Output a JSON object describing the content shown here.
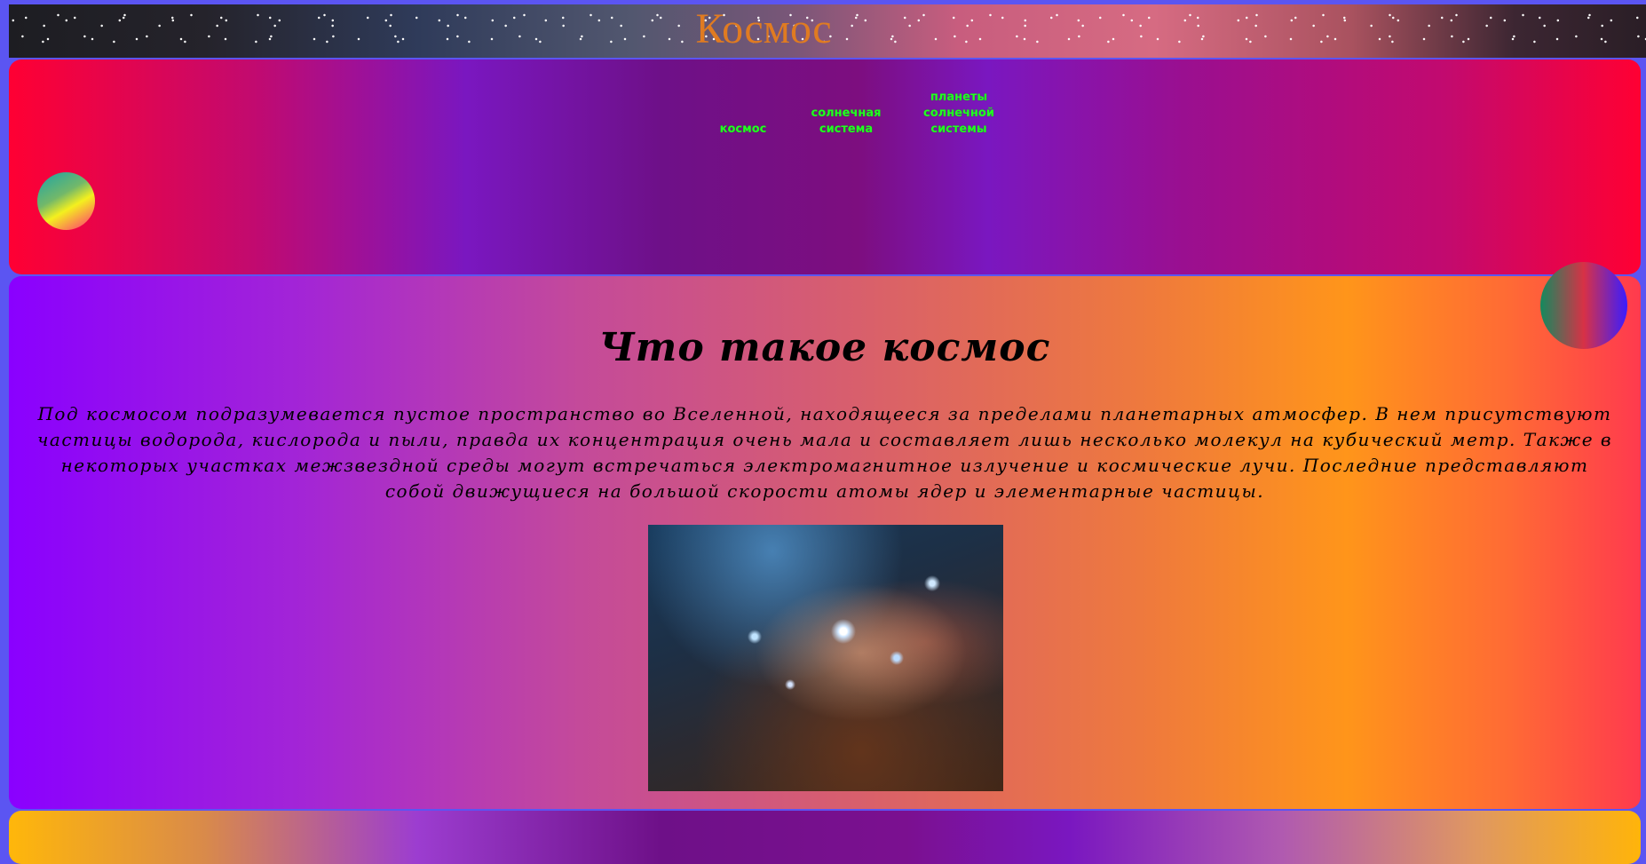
{
  "header": {
    "title": "Космос"
  },
  "nav": {
    "items": [
      {
        "label": "космос"
      },
      {
        "label": "солнечная система"
      },
      {
        "label": "планеты солнечной системы"
      }
    ]
  },
  "main": {
    "heading": "Что такое космос",
    "paragraph": "Под космосом подразумевается пустое пространство во Вселенной, находящееся за пределами планетарных атмосфер. В нем присутствуют частицы водорода, кислорода и пыли, правда их концентрация очень мала и составляет лишь несколько молекул на кубический метр. Также в некоторых участках межзвездной среды могут встречаться электромагнитное излучение и космические лучи. Последние представляют собой движущиеся на большой скорости атомы ядер и элементарные частицы."
  },
  "colors": {
    "title": "#e07b21",
    "nav_text": "#22ff22",
    "page_background": "#5b55f2"
  }
}
